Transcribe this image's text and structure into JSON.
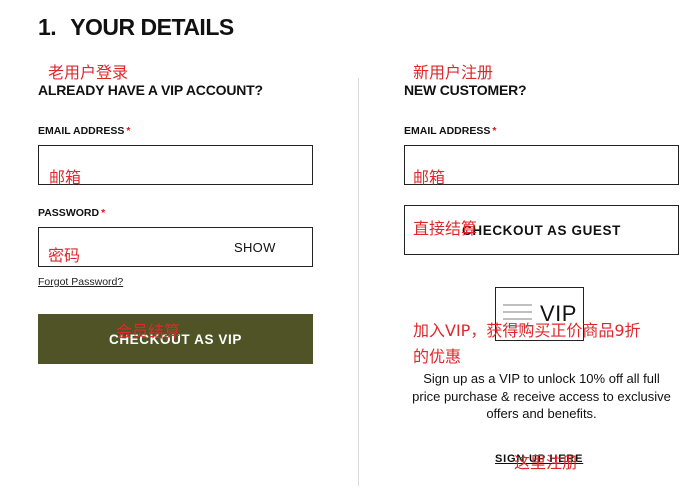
{
  "page": {
    "step_number": "1.",
    "title": "YOUR DETAILS"
  },
  "vip_login": {
    "heading": "ALREADY HAVE A VIP ACCOUNT?",
    "email_label": "EMAIL ADDRESS",
    "email_required_mark": "*",
    "email_value": "",
    "password_label": "PASSWORD",
    "password_required_mark": "*",
    "password_value": "",
    "show_label": "SHOW",
    "forgot_label": "Forgot Password?",
    "checkout_label": "CHECKOUT AS VIP"
  },
  "new_customer": {
    "heading": "NEW CUSTOMER?",
    "email_label": "EMAIL ADDRESS",
    "email_required_mark": "*",
    "email_value": "",
    "guest_label": "CHECKOUT AS GUEST",
    "vip_badge_text": "VIP",
    "promo_lines": [
      "Sign up as a VIP to unlock 10% off all full",
      "price purchase & receive access to exclusive",
      "offers and benefits."
    ],
    "signup_label": "SIGN UP HERE"
  },
  "annotations": {
    "vip_login_heading": "老用户登录",
    "new_customer_heading": "新用户注册",
    "email_left": "邮箱",
    "email_right": "邮箱",
    "password": "密码",
    "checkout_vip": "会员结算",
    "checkout_guest": "直接结算",
    "vip_promo_line1": "加入VIP，获得购买正价商品9折",
    "vip_promo_line2": "的优惠",
    "signup_here": "这里注册"
  },
  "colors": {
    "vip_button_bg": "#4f5326",
    "required_star": "#d41a1a",
    "annotation": "#e0282c",
    "divider": "#d9d9d9"
  }
}
